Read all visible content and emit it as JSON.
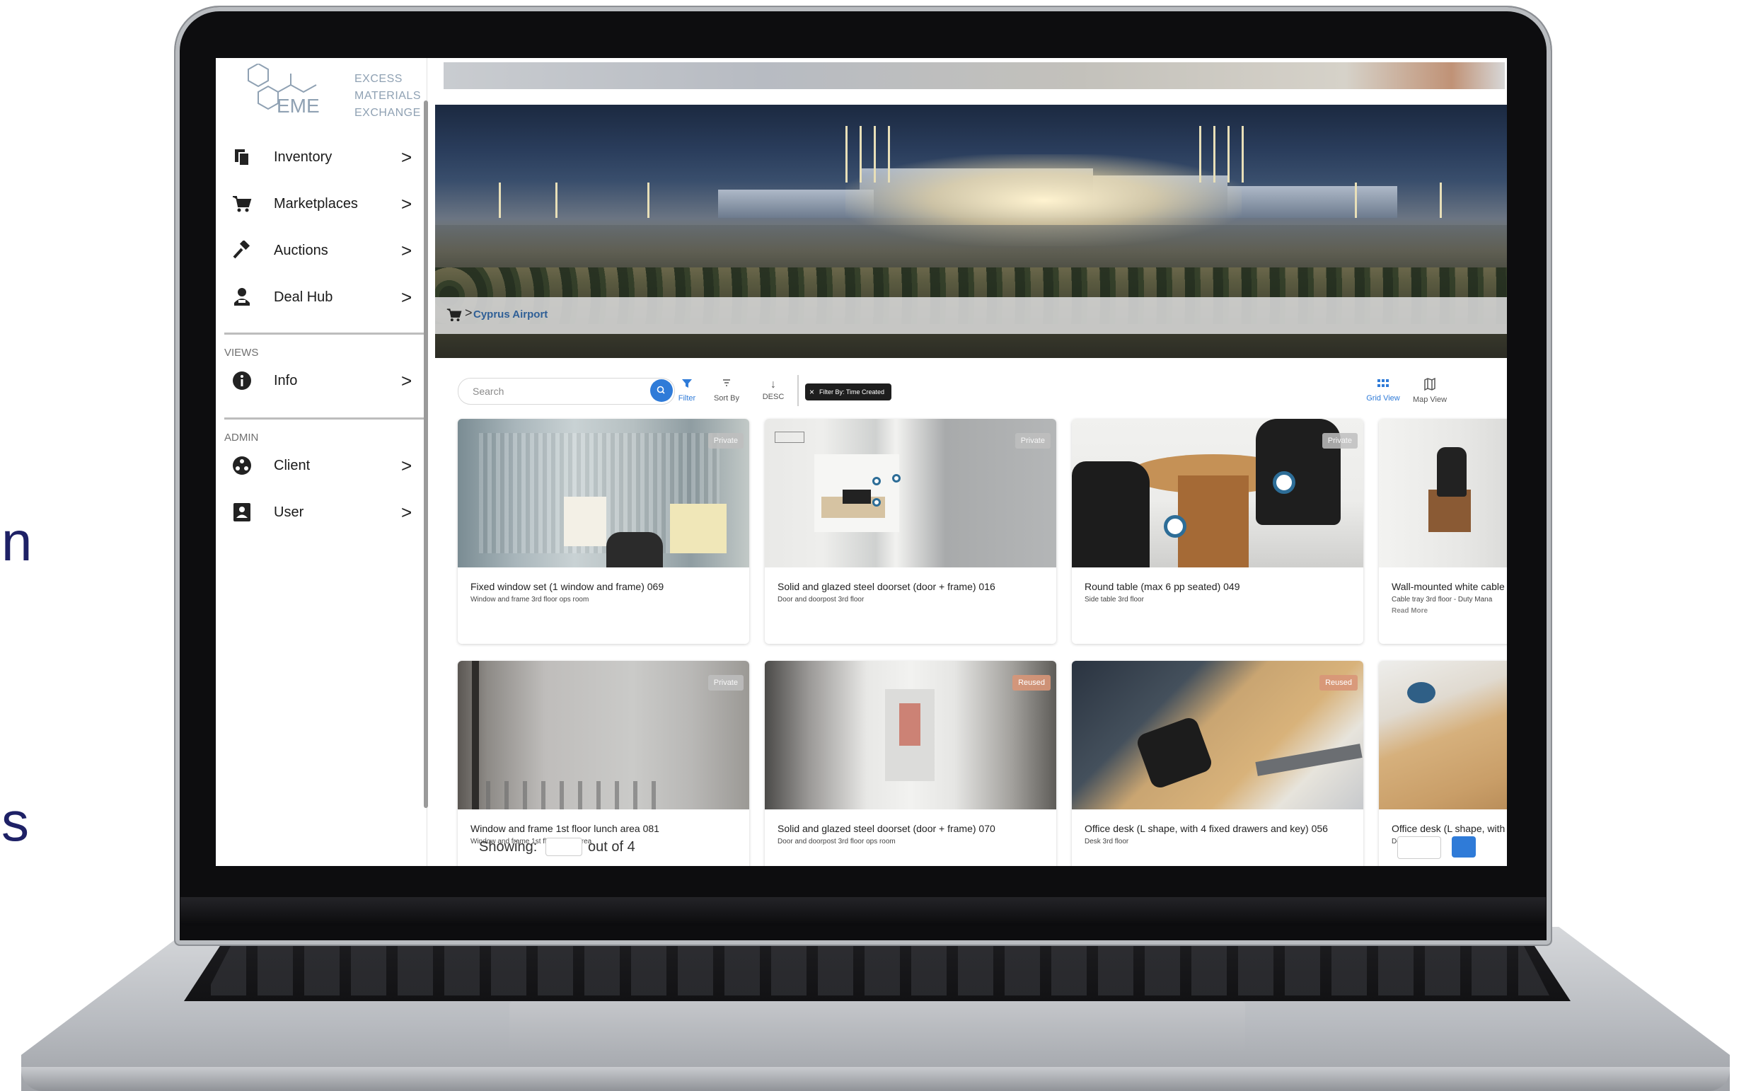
{
  "slide": {
    "edge_letter_1": "n",
    "edge_letter_2": "s"
  },
  "app": {
    "logo": {
      "mark": "EME",
      "line1": "EXCESS",
      "line2": "MATERIALS",
      "line3": "EXCHANGE"
    },
    "sidebar": {
      "main_items": [
        {
          "label": "Inventory",
          "icon": "inventory-icon"
        },
        {
          "label": "Marketplaces",
          "icon": "cart-icon"
        },
        {
          "label": "Auctions",
          "icon": "gavel-icon"
        },
        {
          "label": "Deal Hub",
          "icon": "deal-hub-icon"
        }
      ],
      "views_label": "VIEWS",
      "views_items": [
        {
          "label": "Info",
          "icon": "info-icon"
        }
      ],
      "admin_label": "ADMIN",
      "admin_items": [
        {
          "label": "Client",
          "icon": "client-icon"
        },
        {
          "label": "User",
          "icon": "user-badge-icon"
        }
      ],
      "chevron": ">"
    },
    "breadcrumb": {
      "separator": ">",
      "current": "Cyprus Airport"
    },
    "toolbar": {
      "search_placeholder": "Search",
      "filter_label": "Filter",
      "sort_label": "Sort By",
      "order_label": "DESC",
      "chip_label": "Filter By: Time Created",
      "grid_view_label": "Grid View",
      "map_view_label": "Map View"
    },
    "colors": {
      "accent": "#2f7bd8",
      "breadcrumb": "#2f5f96",
      "reused_badge": "#d8967a"
    },
    "items": [
      {
        "title": "Fixed window set (1 window and frame) 069",
        "subtitle": "Window and frame 3rd floor ops room",
        "badge": "Private"
      },
      {
        "title": "Solid and glazed steel doorset (door + frame) 016",
        "subtitle": "Door and doorpost 3rd floor",
        "badge": "Private"
      },
      {
        "title": "Round table (max 6 pp seated) 049",
        "subtitle": "Side table 3rd floor",
        "badge": "Private"
      },
      {
        "title": "Wall-mounted white cable",
        "subtitle": "Cable tray 3rd floor - Duty Mana",
        "read_more": "Read More",
        "badge": ""
      },
      {
        "title": "Window and frame 1st floor lunch area 081",
        "subtitle": "Window and frame 1st floor lunch area",
        "badge": "Private"
      },
      {
        "title": "Solid and glazed steel doorset (door + frame) 070",
        "subtitle": "Door and doorpost 3rd floor ops room",
        "badge": "Reused"
      },
      {
        "title": "Office desk (L shape, with 4 fixed drawers and key) 056",
        "subtitle": "Desk 3rd floor",
        "badge": "Reused"
      },
      {
        "title": "Office desk (L shape, with",
        "subtitle": "Desk 3rd floor",
        "badge": ""
      }
    ],
    "pager": {
      "showing": "Showing:",
      "out_of": "out of 4"
    }
  }
}
